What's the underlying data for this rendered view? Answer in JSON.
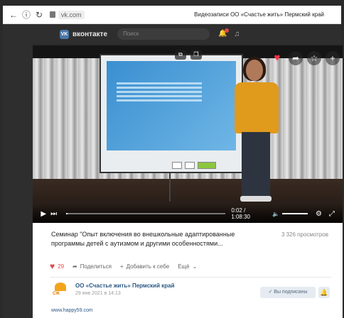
{
  "browser": {
    "back_icon": "back-arrow-icon",
    "info_icon": "info-icon",
    "reload_icon": "reload-icon",
    "url": "vk.com",
    "page_title": "Видеозаписи ОО «Счастье жить» Пермский край"
  },
  "vk": {
    "logo_text": "вконтакте",
    "logo_mark": "VK",
    "search_placeholder": "Поиск"
  },
  "player": {
    "current_time": "0:02",
    "duration": "1:08:30",
    "progress": 0.001
  },
  "video": {
    "title": "Семинар \"Опыт включения во внешкольные адаптированные программы детей с аутизмом и другими особенностями...",
    "views": "3 326 просмотров",
    "likes": "29",
    "share_label": "Поделиться",
    "add_label": "Добавить к себе",
    "more_label": "Ещё"
  },
  "owner": {
    "name": "ОО «Счастье жить» Пермский край",
    "date": "29 янв 2021 в 14:13",
    "logo_text": "СЖ",
    "subscribed_label": "Вы подписаны",
    "website": "www.happy59.com"
  }
}
